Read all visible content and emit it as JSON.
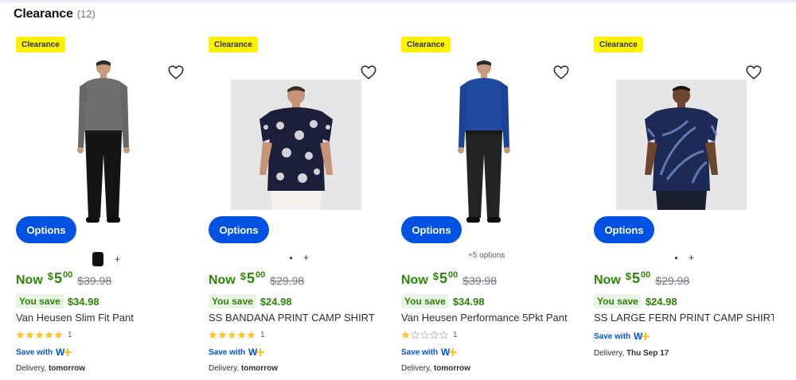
{
  "section": {
    "title": "Clearance",
    "count": "(12)"
  },
  "colors": {
    "badge": "#fff200",
    "button": "#0053e2",
    "price_green": "#2a8703",
    "star": "#ffc220"
  },
  "products": [
    {
      "badge": "Clearance",
      "options_label": "Options",
      "swatch": {
        "plus": "+"
      },
      "now_label": "Now",
      "currency": "$",
      "price_dollars": "5",
      "price_cents": "00",
      "was_price": "$39.98",
      "you_save_label": "You save",
      "save_amount": "$34.98",
      "title": "Van Heusen Slim Fit Pant",
      "rating": 5,
      "rating_count": "1",
      "wplus_label": "Save with",
      "delivery_label": "Delivery,",
      "delivery_day": "tomorrow"
    },
    {
      "badge": "Clearance",
      "options_label": "Options",
      "swatch": {
        "plus": "+"
      },
      "now_label": "Now",
      "currency": "$",
      "price_dollars": "5",
      "price_cents": "00",
      "was_price": "$29.98",
      "you_save_label": "You save",
      "save_amount": "$24.98",
      "title": "SS BANDANA PRINT CAMP SHIRT",
      "rating": 5,
      "rating_count": "1",
      "wplus_label": "Save with",
      "delivery_label": "Delivery,",
      "delivery_day": "tomorrow"
    },
    {
      "badge": "Clearance",
      "options_label": "Options",
      "more_options": "+5 options",
      "now_label": "Now",
      "currency": "$",
      "price_dollars": "5",
      "price_cents": "00",
      "was_price": "$39.98",
      "you_save_label": "You save",
      "save_amount": "$34.98",
      "title": "Van Heusen Performance 5Pkt Pant",
      "rating": 1,
      "rating_count": "1",
      "wplus_label": "Save with",
      "delivery_label": "Delivery,",
      "delivery_day": "tomorrow"
    },
    {
      "badge": "Clearance",
      "options_label": "Options",
      "swatch": {
        "plus": "+"
      },
      "now_label": "Now",
      "currency": "$",
      "price_dollars": "5",
      "price_cents": "00",
      "was_price": "$29.98",
      "you_save_label": "You save",
      "save_amount": "$24.98",
      "title": "SS LARGE FERN PRINT CAMP SHIRT",
      "wplus_label": "Save with",
      "delivery_label": "Delivery,",
      "delivery_day": "Thu Sep 17"
    }
  ]
}
